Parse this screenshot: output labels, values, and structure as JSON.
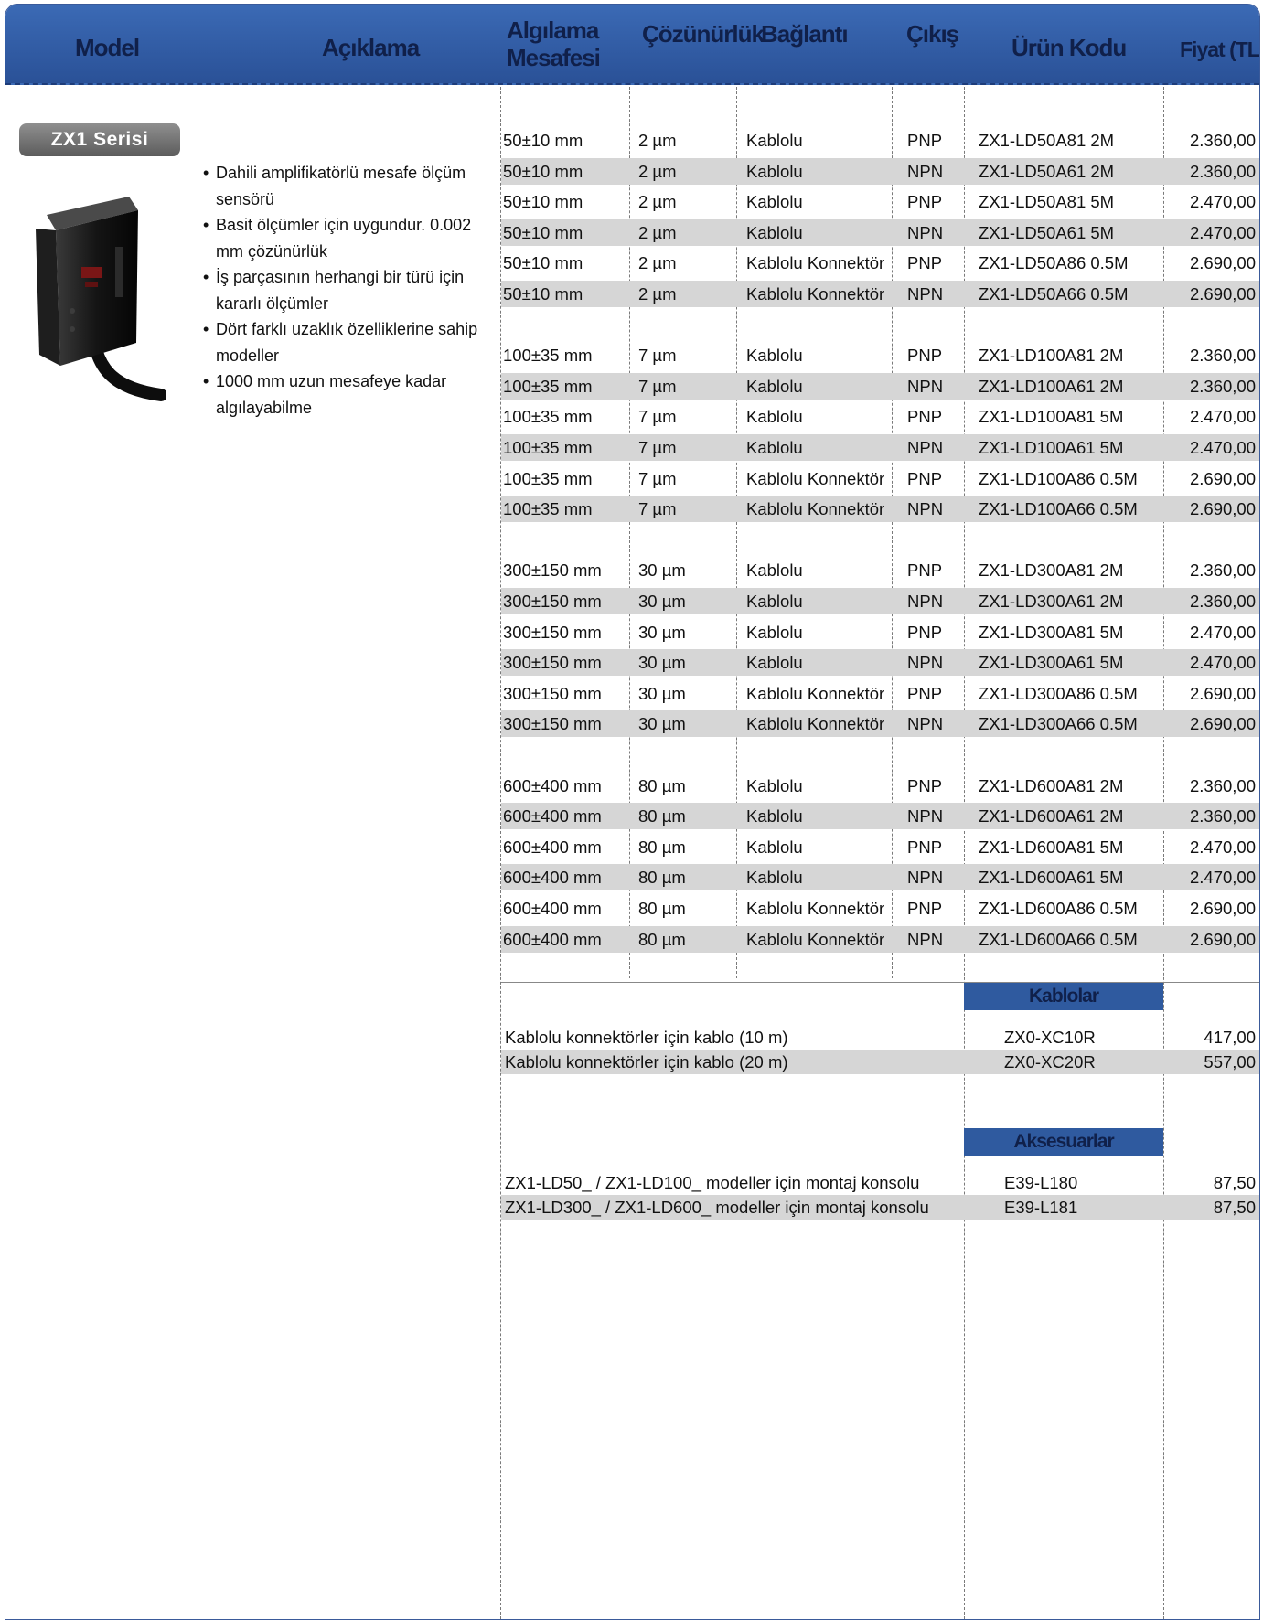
{
  "header": {
    "model": "Model",
    "aciklama": "Açıklama",
    "algilama_line1": "Algılama",
    "algilama_line2": "Mesafesi",
    "cozunurluk": "Çözünürlük",
    "baglanti": "Bağlantı",
    "cikis": "Çıkış",
    "urun_kodu": "Ürün Kodu",
    "fiyat": "Fiyat (TL)"
  },
  "series_label": "ZX1 Serisi",
  "description": [
    "Dahili amplifikatörlü mesafe ölçüm sensörü",
    "Basit ölçümler için uygundur. 0.002 mm çözünürlük",
    "İş parçasının herhangi bir türü için kararlı ölçümler",
    "Dört farklı uzaklık özelliklerine sahip modeller",
    "1000 mm uzun mesafeye kadar algılayabilme"
  ],
  "products": [
    {
      "dist": "50±10 mm",
      "res": "2 µm",
      "conn": "Kablolu",
      "out": "PNP",
      "code": "ZX1-LD50A81 2M",
      "price": "2.360,00"
    },
    {
      "dist": "50±10 mm",
      "res": "2 µm",
      "conn": "Kablolu",
      "out": "NPN",
      "code": "ZX1-LD50A61 2M",
      "price": "2.360,00"
    },
    {
      "dist": "50±10 mm",
      "res": "2 µm",
      "conn": "Kablolu",
      "out": "PNP",
      "code": "ZX1-LD50A81 5M",
      "price": "2.470,00"
    },
    {
      "dist": "50±10 mm",
      "res": "2 µm",
      "conn": "Kablolu",
      "out": "NPN",
      "code": "ZX1-LD50A61 5M",
      "price": "2.470,00"
    },
    {
      "dist": "50±10 mm",
      "res": "2 µm",
      "conn": "Kablolu Konnektör",
      "out": "PNP",
      "code": "ZX1-LD50A86 0.5M",
      "price": "2.690,00"
    },
    {
      "dist": "50±10 mm",
      "res": "2 µm",
      "conn": "Kablolu Konnektör",
      "out": "NPN",
      "code": "ZX1-LD50A66 0.5M",
      "price": "2.690,00"
    },
    {
      "dist": "100±35 mm",
      "res": "7 µm",
      "conn": "Kablolu",
      "out": "PNP",
      "code": "ZX1-LD100A81 2M",
      "price": "2.360,00"
    },
    {
      "dist": "100±35 mm",
      "res": "7 µm",
      "conn": "Kablolu",
      "out": "NPN",
      "code": "ZX1-LD100A61 2M",
      "price": "2.360,00"
    },
    {
      "dist": "100±35 mm",
      "res": "7 µm",
      "conn": "Kablolu",
      "out": "PNP",
      "code": "ZX1-LD100A81 5M",
      "price": "2.470,00"
    },
    {
      "dist": "100±35 mm",
      "res": "7 µm",
      "conn": "Kablolu",
      "out": "NPN",
      "code": "ZX1-LD100A61 5M",
      "price": "2.470,00"
    },
    {
      "dist": "100±35 mm",
      "res": "7 µm",
      "conn": "Kablolu Konnektör",
      "out": "PNP",
      "code": "ZX1-LD100A86 0.5M",
      "price": "2.690,00"
    },
    {
      "dist": "100±35 mm",
      "res": "7 µm",
      "conn": "Kablolu Konnektör",
      "out": "NPN",
      "code": "ZX1-LD100A66 0.5M",
      "price": "2.690,00"
    },
    {
      "dist": "300±150 mm",
      "res": "30 µm",
      "conn": "Kablolu",
      "out": "PNP",
      "code": "ZX1-LD300A81 2M",
      "price": "2.360,00"
    },
    {
      "dist": "300±150 mm",
      "res": "30 µm",
      "conn": "Kablolu",
      "out": "NPN",
      "code": "ZX1-LD300A61 2M",
      "price": "2.360,00"
    },
    {
      "dist": "300±150 mm",
      "res": "30 µm",
      "conn": "Kablolu",
      "out": "PNP",
      "code": "ZX1-LD300A81 5M",
      "price": "2.470,00"
    },
    {
      "dist": "300±150 mm",
      "res": "30 µm",
      "conn": "Kablolu",
      "out": "NPN",
      "code": "ZX1-LD300A61 5M",
      "price": "2.470,00"
    },
    {
      "dist": "300±150 mm",
      "res": "30 µm",
      "conn": "Kablolu Konnektör",
      "out": "PNP",
      "code": "ZX1-LD300A86 0.5M",
      "price": "2.690,00"
    },
    {
      "dist": "300±150 mm",
      "res": "30 µm",
      "conn": "Kablolu Konnektör",
      "out": "NPN",
      "code": "ZX1-LD300A66 0.5M",
      "price": "2.690,00"
    },
    {
      "dist": "600±400 mm",
      "res": "80 µm",
      "conn": "Kablolu",
      "out": "PNP",
      "code": "ZX1-LD600A81 2M",
      "price": "2.360,00"
    },
    {
      "dist": "600±400 mm",
      "res": "80 µm",
      "conn": "Kablolu",
      "out": "NPN",
      "code": "ZX1-LD600A61 2M",
      "price": "2.360,00"
    },
    {
      "dist": "600±400 mm",
      "res": "80 µm",
      "conn": "Kablolu",
      "out": "PNP",
      "code": "ZX1-LD600A81 5M",
      "price": "2.470,00"
    },
    {
      "dist": "600±400 mm",
      "res": "80 µm",
      "conn": "Kablolu",
      "out": "NPN",
      "code": "ZX1-LD600A61 5M",
      "price": "2.470,00"
    },
    {
      "dist": "600±400 mm",
      "res": "80 µm",
      "conn": "Kablolu Konnektör",
      "out": "PNP",
      "code": "ZX1-LD600A86 0.5M",
      "price": "2.690,00"
    },
    {
      "dist": "600±400 mm",
      "res": "80 µm",
      "conn": "Kablolu Konnektör",
      "out": "NPN",
      "code": "ZX1-LD600A66 0.5M",
      "price": "2.690,00"
    }
  ],
  "cables": {
    "title": "Kablolar",
    "items": [
      {
        "desc": "Kablolu konnektörler için kablo (10 m)",
        "code": "ZX0-XC10R",
        "price": "417,00"
      },
      {
        "desc": "Kablolu konnektörler için kablo (20 m)",
        "code": "ZX0-XC20R",
        "price": "557,00"
      }
    ]
  },
  "accessories": {
    "title": "Aksesuarlar",
    "items": [
      {
        "desc": "ZX1-LD50_ / ZX1-LD100_  modeller için montaj konsolu",
        "code": "E39-L180",
        "price": "87,50"
      },
      {
        "desc": "ZX1-LD300_ / ZX1-LD600_  modeller için montaj konsolu",
        "code": "E39-L181",
        "price": "87,50"
      }
    ]
  },
  "colors": {
    "header_blue": "#2f5a9f",
    "header_text": "#10204a",
    "row_shade": "#d6d6d6",
    "badge_gray": "#6e6e6e"
  }
}
